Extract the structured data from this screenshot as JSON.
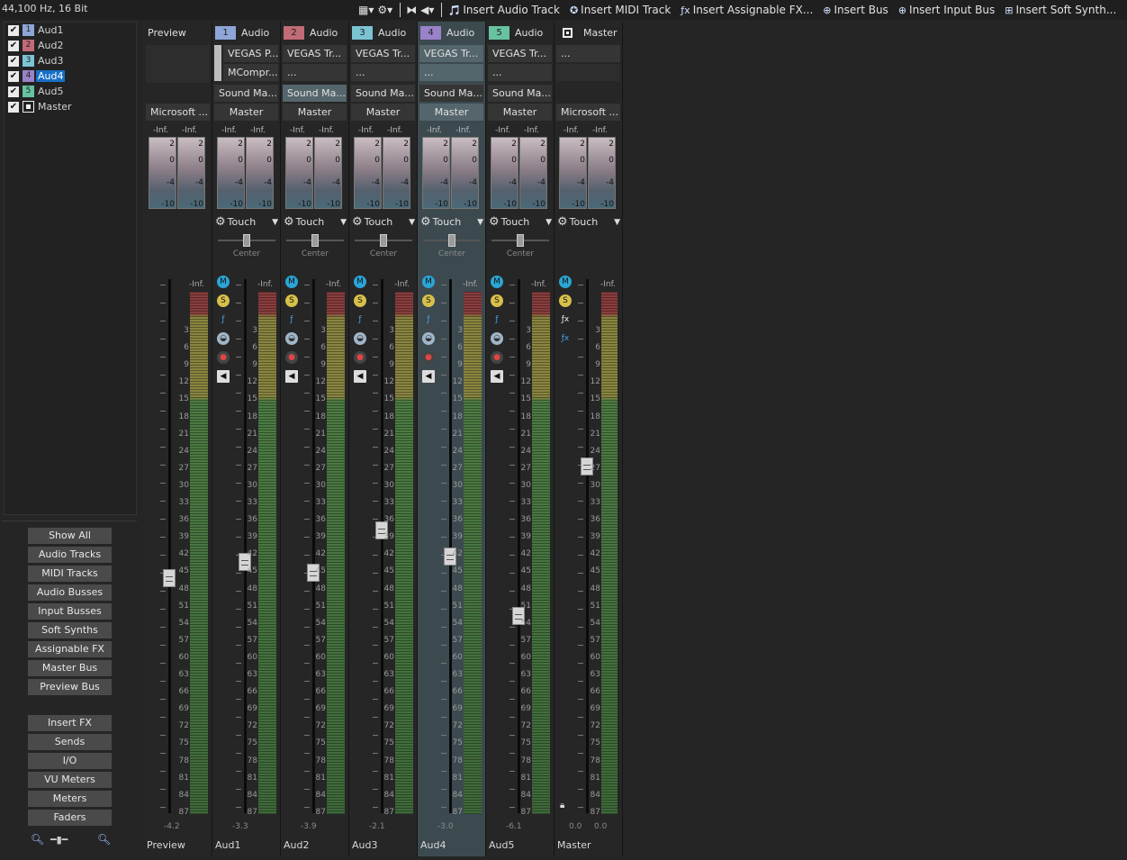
{
  "status": {
    "sample_rate": "44,100 Hz, 16 Bit"
  },
  "toolbar": {
    "actions": [
      {
        "label": "Insert Audio Track",
        "icon": "insert-audio-track-icon"
      },
      {
        "label": "Insert MIDI Track",
        "icon": "insert-midi-track-icon"
      },
      {
        "label": "Insert Assignable FX...",
        "icon": "insert-assignable-fx-icon"
      },
      {
        "label": "Insert Bus",
        "icon": "insert-bus-icon"
      },
      {
        "label": "Insert Input Bus",
        "icon": "insert-input-bus-icon"
      },
      {
        "label": "Insert Soft Synth...",
        "icon": "insert-soft-synth-icon"
      }
    ]
  },
  "track_list": [
    {
      "num": "1",
      "name": "Aud1",
      "color": "#8ea6d6"
    },
    {
      "num": "2",
      "name": "Aud2",
      "color": "#c06b76"
    },
    {
      "num": "3",
      "name": "Aud3",
      "color": "#7cc3d3"
    },
    {
      "num": "4",
      "name": "Aud4",
      "color": "#9a82c8",
      "selected": true
    },
    {
      "num": "5",
      "name": "Aud5",
      "color": "#67c2a0"
    },
    {
      "num": "",
      "name": "Master",
      "color": "#ffffff"
    }
  ],
  "side_buttons": {
    "group1": [
      "Show All",
      "Audio Tracks",
      "MIDI Tracks",
      "Audio Busses",
      "Input Busses",
      "Soft Synths",
      "Assignable FX",
      "Master Bus",
      "Preview Bus"
    ],
    "group2": [
      "Insert FX",
      "Sends",
      "I/O",
      "VU Meters",
      "Meters",
      "Faders"
    ]
  },
  "channels": [
    {
      "id": "preview",
      "num": "",
      "type": "Preview",
      "color": "",
      "fx": [],
      "fx_more": "",
      "send": "",
      "output": "Microsoft ...",
      "automation": "",
      "center": "",
      "value": "-4.2",
      "name": "Preview",
      "fader_level": 0.56
    },
    {
      "id": "aud1",
      "num": "1",
      "type": "Audio",
      "color": "#8ea6d6",
      "fx": [
        "VEGAS P...",
        "MCompr..."
      ],
      "fx_more": "",
      "send": "Sound Ma...",
      "output": "Master",
      "automation": "Touch",
      "center": "Center",
      "value": "-3.3",
      "name": "Aud1",
      "fader_level": 0.53
    },
    {
      "id": "aud2",
      "num": "2",
      "type": "Audio",
      "color": "#c06b76",
      "fx": [
        "VEGAS Tr..."
      ],
      "fx_more": "...",
      "send": "Sound Ma...",
      "output": "Master",
      "automation": "Touch",
      "center": "Center",
      "value": "-3.9",
      "name": "Aud2",
      "fader_level": 0.55
    },
    {
      "id": "aud3",
      "num": "3",
      "type": "Audio",
      "color": "#7cc3d3",
      "fx": [
        "VEGAS Tr..."
      ],
      "fx_more": "...",
      "send": "Sound Ma...",
      "output": "Master",
      "automation": "Touch",
      "center": "Center",
      "value": "-2.1",
      "name": "Aud3",
      "fader_level": 0.47
    },
    {
      "id": "aud4",
      "num": "4",
      "type": "Audio",
      "color": "#9a82c8",
      "fx": [
        "VEGAS Tr..."
      ],
      "fx_more": "...",
      "send": "Sound Ma...",
      "output": "Master",
      "automation": "Touch",
      "center": "Center",
      "value": "-3.0",
      "name": "Aud4",
      "fader_level": 0.52,
      "selected": true
    },
    {
      "id": "aud5",
      "num": "5",
      "type": "Audio",
      "color": "#67c2a0",
      "fx": [
        "VEGAS Tr..."
      ],
      "fx_more": "...",
      "send": "Sound Ma...",
      "output": "Master",
      "automation": "Touch",
      "center": "Center",
      "value": "-6.1",
      "name": "Aud5",
      "fader_level": 0.63
    },
    {
      "id": "master",
      "num": "",
      "type": "Master",
      "color": "",
      "fx": [
        "..."
      ],
      "fx_more": "",
      "send": "",
      "output": "Microsoft ...",
      "automation": "Touch",
      "center": "",
      "value": "0.0",
      "value2": "0.0",
      "name": "Master",
      "fader_level": 0.35
    }
  ],
  "meter_top": {
    "left": "-Inf.",
    "right": "-Inf."
  },
  "meter_scale_small": [
    "2",
    "0",
    "-4",
    "-10"
  ],
  "meter_scale": [
    "3",
    "6",
    "9",
    "12",
    "15",
    "18",
    "21",
    "24",
    "27",
    "30",
    "33",
    "36",
    "39",
    "42",
    "45",
    "48",
    "51",
    "54",
    "57",
    "60",
    "63",
    "66",
    "69",
    "72",
    "75",
    "78",
    "81",
    "84",
    "87"
  ],
  "colors": {
    "selected_strip": "#3c4a50",
    "accent": "#1670c7"
  }
}
